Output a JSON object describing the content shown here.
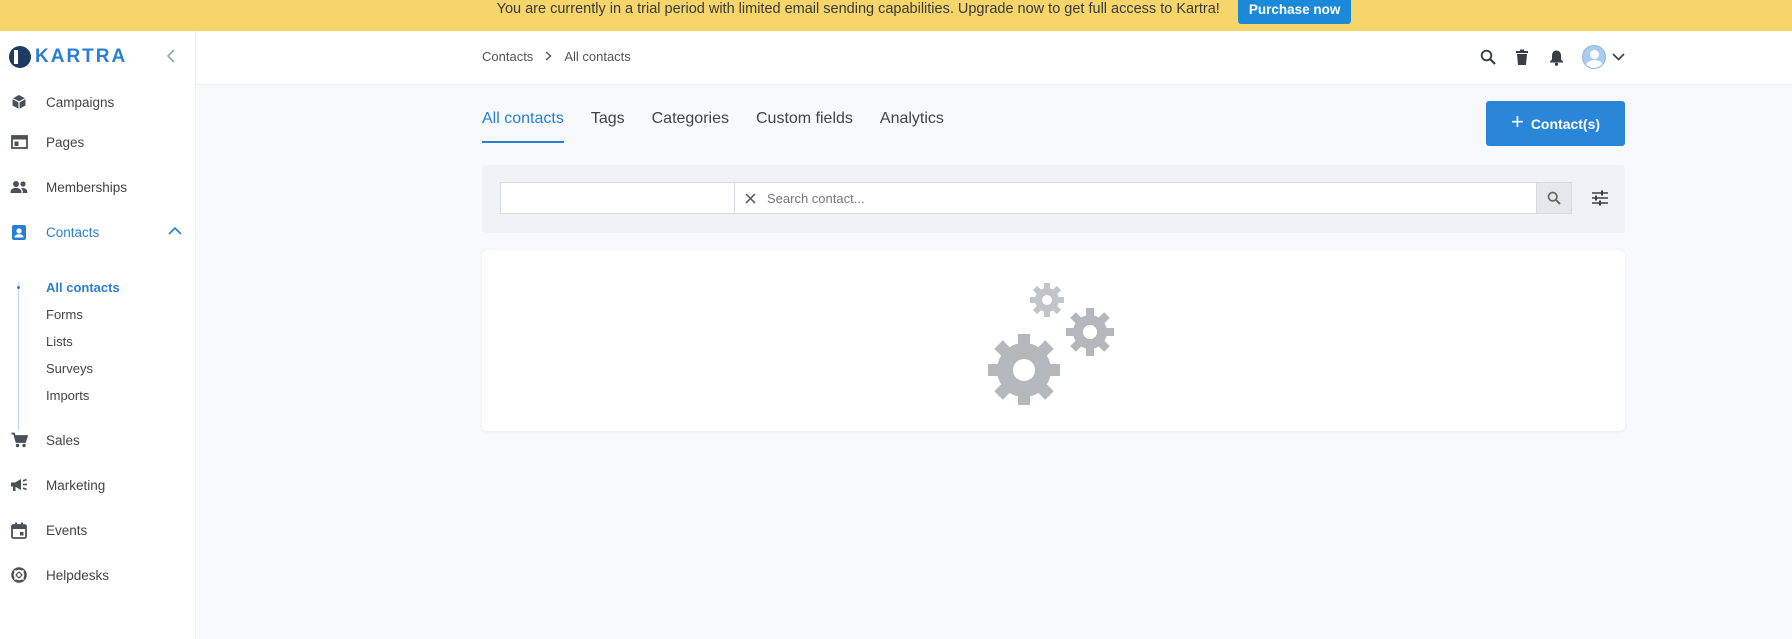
{
  "banner": {
    "text": "You are currently in a trial period with limited email sending capabilities. Upgrade now to get full access to Kartra!",
    "button_label": "Purchase now"
  },
  "logo": {
    "text": "KARTRA"
  },
  "sidebar": {
    "items": [
      {
        "label": "Campaigns",
        "icon": "cube-icon"
      },
      {
        "label": "Pages",
        "icon": "browser-window-icon"
      },
      {
        "label": "Memberships",
        "icon": "people-icon"
      },
      {
        "label": "Contacts",
        "icon": "contact-card-icon",
        "active": true
      },
      {
        "label": "Sales",
        "icon": "cart-icon"
      },
      {
        "label": "Marketing",
        "icon": "megaphone-icon"
      },
      {
        "label": "Events",
        "icon": "calendar-icon"
      },
      {
        "label": "Helpdesks",
        "icon": "lifebuoy-icon"
      }
    ],
    "contacts_sub": [
      {
        "label": "All contacts",
        "active": true
      },
      {
        "label": "Forms"
      },
      {
        "label": "Lists"
      },
      {
        "label": "Surveys"
      },
      {
        "label": "Imports"
      }
    ]
  },
  "breadcrumb": {
    "parent": "Contacts",
    "current": "All contacts"
  },
  "tabs": [
    {
      "label": "All contacts",
      "active": true
    },
    {
      "label": "Tags"
    },
    {
      "label": "Categories"
    },
    {
      "label": "Custom fields"
    },
    {
      "label": "Analytics"
    }
  ],
  "add_button": {
    "label": "Contact(s)"
  },
  "search": {
    "placeholder": "Search contact..."
  },
  "colors": {
    "accent": "#2a7fd4",
    "banner": "#f6d56b",
    "primary_button": "#2a86d9"
  }
}
